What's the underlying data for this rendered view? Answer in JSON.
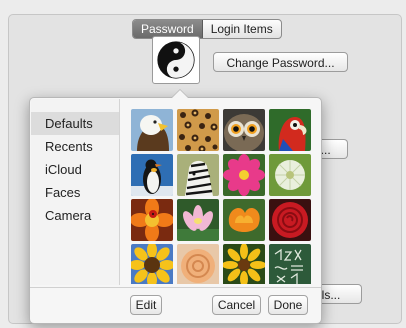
{
  "tabs": {
    "password": "Password",
    "login_items": "Login Items"
  },
  "buttons": {
    "change_password": "Change Password...",
    "partial_right": "e...",
    "partial_controls": "rols..."
  },
  "popover": {
    "sidebar": [
      "Defaults",
      "Recents",
      "iCloud",
      "Faces",
      "Camera"
    ],
    "selected_index": 0,
    "pictures": [
      "eagle-picture",
      "leopard-picture",
      "owl-picture",
      "parrot-picture",
      "penguin-picture",
      "zebra-picture",
      "pink-flower-picture",
      "dandelion-picture",
      "ladybug-flower-picture",
      "lotus-picture",
      "orange-flower-picture",
      "rose-picture",
      "sunflower-picture",
      "peach-rose-picture",
      "daisy-picture",
      "chalkboard-picture"
    ],
    "edit_label": "Edit",
    "cancel_label": "Cancel",
    "done_label": "Done"
  },
  "colors": {
    "selection": "#dcdcdc",
    "segmented_active": "#7a7a7a"
  }
}
